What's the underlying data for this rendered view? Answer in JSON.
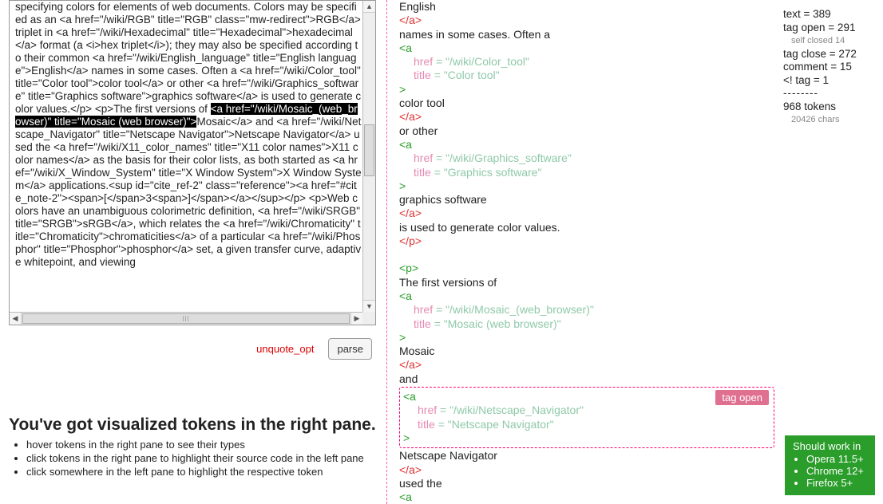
{
  "left": {
    "source_pre": "specifying colors for elements of web documents. Colors may be specified as an <a href=\"/wiki/RGB\" title=\"RGB\" class=\"mw-redirect\">RGB</a> triplet in <a href=\"/wiki/Hexadecimal\" title=\"Hexadecimal\">hexadecimal</a> format (a <i>hex triplet</i>); they may also be specified according to their common <a href=\"/wiki/English_language\" title=\"English language\">English</a> names in some cases. Often a <a href=\"/wiki/Color_tool\" title=\"Color tool\">color tool</a> or other <a href=\"/wiki/Graphics_software\" title=\"Graphics software\">graphics software</a> is used to generate color values.</p>\n<p>The first versions of ",
    "source_hl": "<a href=\"/wiki/Mosaic_(web_browser)\" title=\"Mosaic (web browser)\">",
    "source_post": "Mosaic</a> and <a href=\"/wiki/Netscape_Navigator\" title=\"Netscape Navigator\">Netscape Navigator</a> used the <a href=\"/wiki/X11_color_names\" title=\"X11 color names\">X11 color names</a> as the basis for their color lists, as both started as <a href=\"/wiki/X_Window_System\" title=\"X Window System\">X Window System</a> applications.<sup id=\"cite_ref-2\" class=\"reference\"><a href=\"#cite_note-2\"><span>[</span>3<span>]</span></a></sup></p>\n<p>Web colors have an unambiguous colorimetric definition, <a href=\"/wiki/SRGB\" title=\"SRGB\">sRGB</a>, which relates the <a href=\"/wiki/Chromaticity\" title=\"Chromaticity\">chromaticities</a> of a particular <a href=\"/wiki/Phosphor\" title=\"Phosphor\">phosphor</a> set, a given transfer curve, adaptive whitepoint, and viewing"
  },
  "controls": {
    "link": "unquote_opt",
    "button": "parse"
  },
  "instructions": {
    "heading": "You've got visualized tokens in the right pane.",
    "items": [
      "hover tokens in the right pane to see their types",
      "click tokens in the right pane to highlight their source code in the left pane",
      "click somewhere in the left pane to highlight the respective token"
    ]
  },
  "tokens": {
    "t0": "English",
    "t1": "</a>",
    "t2": " names in some cases. Often a",
    "t3": "<a",
    "t3a_n": "href",
    "t3a_v": "= \"/wiki/Color_tool\"",
    "t3b_n": "title",
    "t3b_v": "= \"Color tool\"",
    "gt": ">",
    "t4": "color tool",
    "t5": "</a>",
    "t6": " or other",
    "t7": "<a",
    "t7a_n": "href",
    "t7a_v": "= \"/wiki/Graphics_software\"",
    "t7b_n": "title",
    "t7b_v": "= \"Graphics software\"",
    "t8": "graphics software",
    "t9": "</a>",
    "t10": " is used to generate color values.",
    "t11": "</p>",
    "t12": "<p>",
    "t13": "The first versions of",
    "t14": "<a",
    "t14a_n": "href",
    "t14a_v": "= \"/wiki/Mosaic_(web_browser)\"",
    "t14b_n": "title",
    "t14b_v": "= \"Mosaic (web browser)\"",
    "t15": "Mosaic",
    "t16": "</a>",
    "t17": " and",
    "t18": "<a",
    "t18a_n": "href",
    "t18a_v": "= \"/wiki/Netscape_Navigator\"",
    "t18b_n": "title",
    "t18b_v": "= \"Netscape Navigator\"",
    "hover_badge": "tag open",
    "t19": "Netscape Navigator",
    "t20": "</a>",
    "t21": " used the",
    "t22": "<a"
  },
  "stats": {
    "text": "text = 389",
    "tag_open": "tag open = 291",
    "self_closed": "self closed 14",
    "tag_close": "tag close = 272",
    "comment": "comment = 15",
    "bang": "<! tag = 1",
    "sep": "--------",
    "tokens": "968 tokens",
    "chars": "20426 chars"
  },
  "browsers": {
    "heading": "Should work in",
    "items": [
      "Opera 11.5+",
      "Chrome 12+",
      "Firefox 5+"
    ]
  }
}
